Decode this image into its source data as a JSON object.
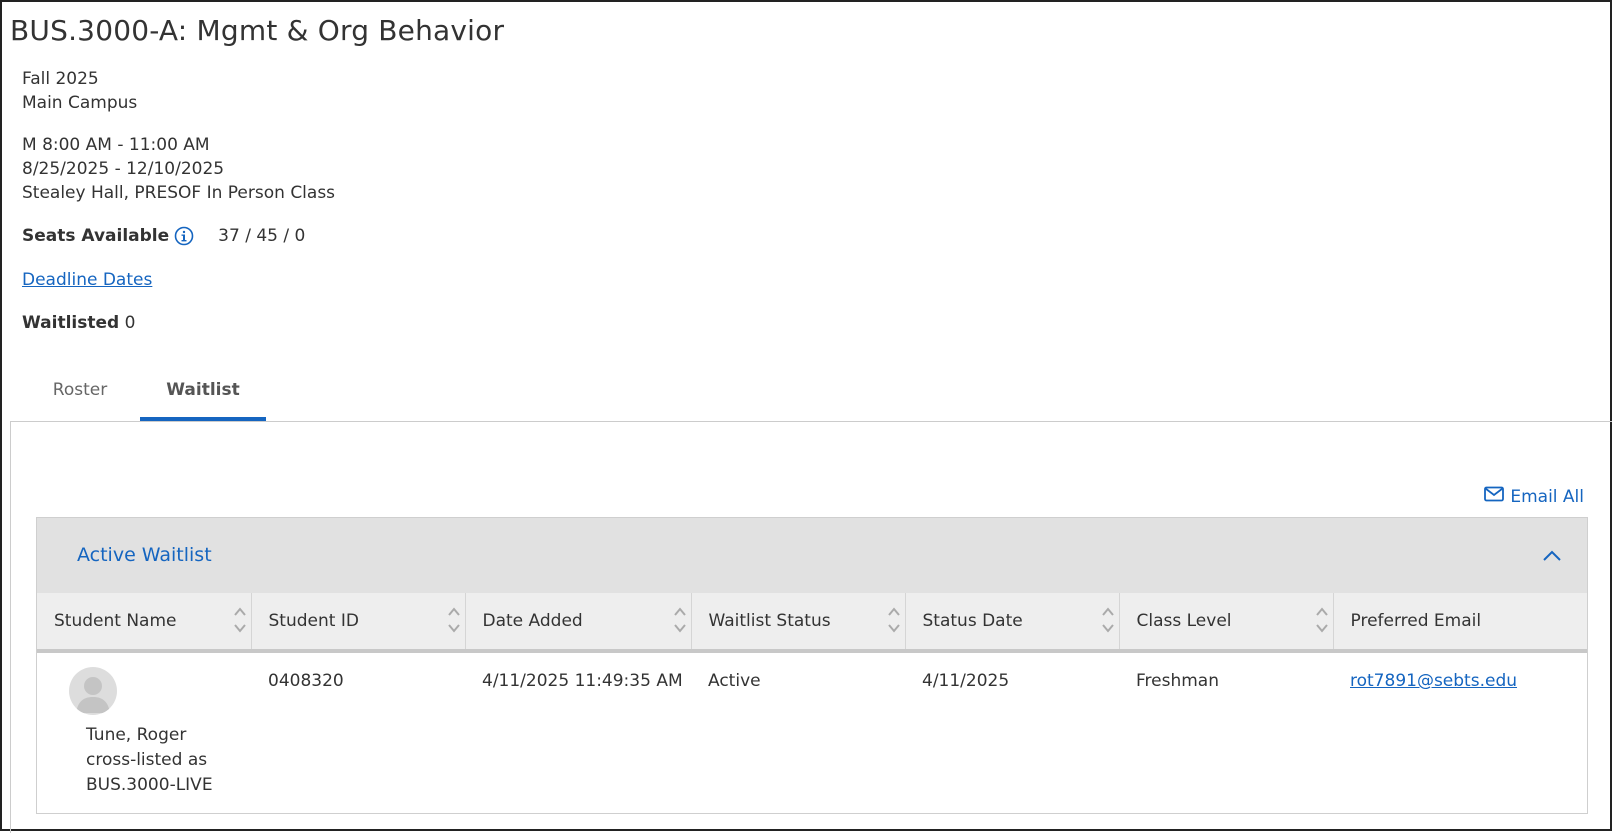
{
  "page": {
    "title": "BUS.3000-A: Mgmt & Org Behavior"
  },
  "course_info": {
    "term": "Fall 2025",
    "campus": "Main Campus",
    "meeting_time": "M 8:00 AM - 11:00 AM",
    "date_range": "8/25/2025 - 12/10/2025",
    "location": "Stealey Hall, PRESOF In Person Class",
    "seats_label": "Seats Available",
    "seats_value": "37 / 45 / 0",
    "deadline_link": "Deadline Dates",
    "waitlisted_label": "Waitlisted",
    "waitlisted_value": "0"
  },
  "tabs": [
    {
      "label": "Roster",
      "active": false
    },
    {
      "label": "Waitlist",
      "active": true
    }
  ],
  "actions": {
    "email_all": "Email All"
  },
  "waitlist": {
    "title": "Active Waitlist",
    "columns": [
      "Student Name",
      "Student ID",
      "Date Added",
      "Waitlist Status",
      "Status Date",
      "Class Level",
      "Preferred Email"
    ],
    "rows": [
      {
        "name": "Tune, Roger",
        "cross_listed_label": "cross-listed as",
        "cross_listed_course": "BUS.3000-LIVE",
        "student_id": "0408320",
        "date_added": "4/11/2025 11:49:35 AM",
        "waitlist_status": "Active",
        "status_date": "4/11/2025",
        "class_level": "Freshman",
        "preferred_email": "rot7891@sebts.edu"
      }
    ]
  },
  "icons": {
    "info": "info-icon",
    "email": "envelope-icon",
    "collapse": "chevron-up-icon",
    "sort": "sort-icon",
    "avatar": "user-avatar-icon"
  },
  "colors": {
    "accent": "#1565c0",
    "card_header": "#e1e1e1",
    "table_header": "#eeeeee"
  }
}
